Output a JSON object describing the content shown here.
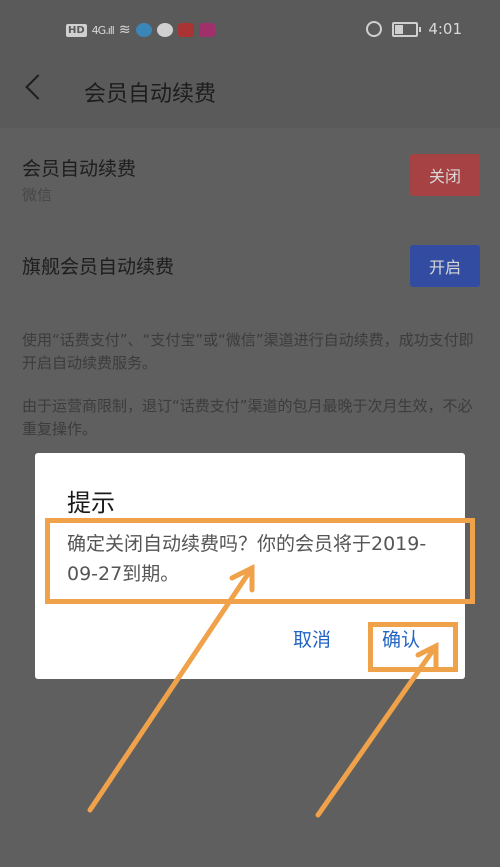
{
  "status_bar": {
    "network": "4G",
    "time": "4:01",
    "icons": [
      "hd-icon",
      "signal-icon",
      "wifi-icon",
      "app-icon",
      "app-icon",
      "app-icon",
      "video-icon",
      "alarm-icon",
      "battery-icon"
    ]
  },
  "header": {
    "title": "会员自动续费"
  },
  "settings": {
    "rows": [
      {
        "title": "会员自动续费",
        "subtitle": "微信",
        "button": "关闭",
        "button_color": "#c0393b"
      },
      {
        "title": "旗舰会员自动续费",
        "button": "开启",
        "button_color": "#2446b8"
      }
    ],
    "notes": [
      "使用“话费支付”、“支付宝”或“微信”渠道进行自动续费，成功支付即开启自动续费服务。",
      "由于运营商限制，退订“话费支付”渠道的包月最晚于次月生效，不必重复操作。"
    ]
  },
  "dialog": {
    "title": "提示",
    "message": "确定关闭自动续费吗？你的会员将于2019-09-27到期。",
    "cancel": "取消",
    "confirm": "确认"
  },
  "colors": {
    "highlight": "#f0a24b",
    "dialog_button": "#2365c4"
  }
}
